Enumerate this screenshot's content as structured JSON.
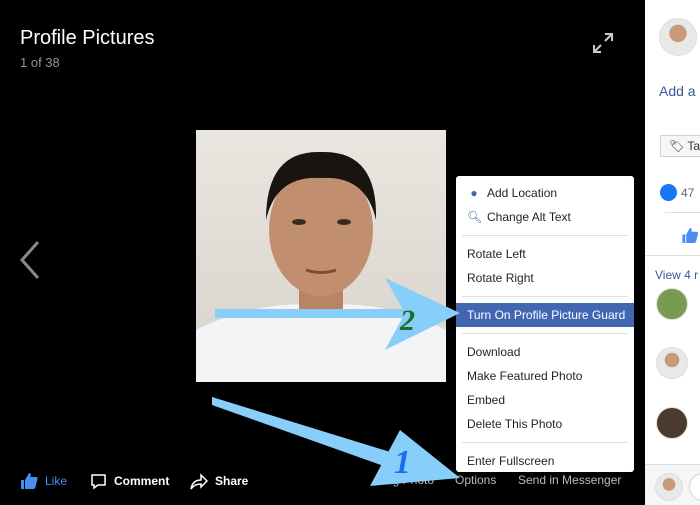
{
  "viewer": {
    "title": "Profile Pictures",
    "count": "1 of 38"
  },
  "actions": {
    "like": "Like",
    "comment": "Comment",
    "share": "Share"
  },
  "footer": {
    "tag": "Tag Photo",
    "options": "Options",
    "send": "Send in Messenger"
  },
  "menu": {
    "items": [
      {
        "label": "Add Location",
        "icon": "location-pin-icon"
      },
      {
        "label": "Change Alt Text",
        "icon": "search-icon"
      },
      {
        "label": "Rotate Left"
      },
      {
        "label": "Rotate Right"
      },
      {
        "label": "Turn On Profile Picture Guard",
        "highlighted": true
      },
      {
        "label": "Download"
      },
      {
        "label": "Make Featured Photo"
      },
      {
        "label": "Embed"
      },
      {
        "label": "Delete This Photo"
      },
      {
        "label": "Enter Fullscreen"
      }
    ]
  },
  "panel": {
    "add": "Add a",
    "tag": "Ta",
    "likes": "47",
    "view": "View 4 r"
  },
  "annotations": {
    "one": "1",
    "two": "2",
    "color": "#87cefa"
  },
  "colors": {
    "accent": "#4267b2",
    "link": "#385898"
  }
}
